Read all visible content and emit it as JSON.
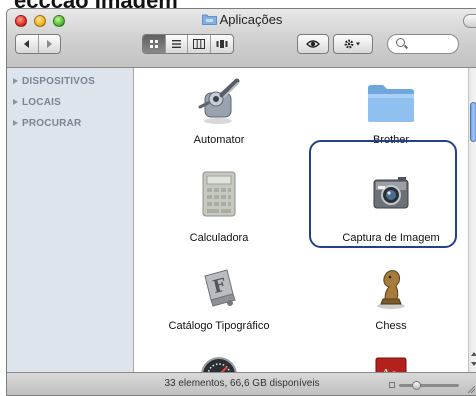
{
  "page_heading": "eccção Imagem",
  "window": {
    "title": "Aplicações"
  },
  "toolbar": {
    "nav": [
      "back",
      "forward"
    ],
    "view_modes": [
      "icon-view",
      "list-view",
      "column-view",
      "coverflow-view"
    ],
    "active_view": "icon-view",
    "search_placeholder": ""
  },
  "sidebar": {
    "sections": [
      {
        "label": "DISPOSITIVOS"
      },
      {
        "label": "LOCAIS"
      },
      {
        "label": "PROCURAR"
      }
    ]
  },
  "items": [
    {
      "name": "Automator",
      "icon": "automator-icon"
    },
    {
      "name": "Brother",
      "icon": "folder-icon"
    },
    {
      "name": "Calculadora",
      "icon": "calculator-icon"
    },
    {
      "name": "Captura de Imagem",
      "icon": "image-capture-icon",
      "selected": true
    },
    {
      "name": "Catálogo Tipográfico",
      "icon": "font-book-icon"
    },
    {
      "name": "Chess",
      "icon": "chess-icon"
    },
    {
      "name": "",
      "icon": "dashboard-icon"
    },
    {
      "name": "",
      "icon": "dictionary-icon"
    }
  ],
  "dictionary_glyph": "Aa",
  "status": {
    "text": "33 elementos, 66,6 GB disponíveis"
  },
  "colors": {
    "sidebar_bg": "#dde4ec",
    "highlight_border": "#23418a",
    "scroll_thumb": "#6c9de0"
  }
}
